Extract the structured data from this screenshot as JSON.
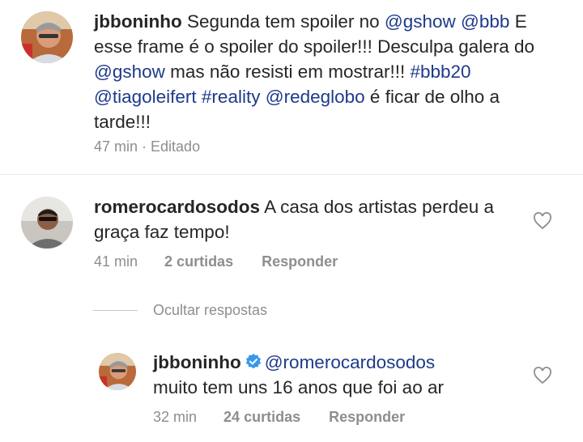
{
  "post": {
    "username": "jbboninho",
    "caption_parts": [
      {
        "t": " Segunda tem spoiler no ",
        "link": false
      },
      {
        "t": "@gshow",
        "link": true
      },
      {
        "t": " ",
        "link": false
      },
      {
        "t": "@bbb",
        "link": true
      },
      {
        "t": " E esse frame é o spoiler do spoiler!!! Desculpa galera do ",
        "link": false
      },
      {
        "t": "@gshow",
        "link": true
      },
      {
        "t": " mas não resisti em mostrar!!! ",
        "link": false
      },
      {
        "t": "#bbb20",
        "link": true
      },
      {
        "t": " ",
        "link": false
      },
      {
        "t": "@tiagoleifert",
        "link": true
      },
      {
        "t": " ",
        "link": false
      },
      {
        "t": "#reality",
        "link": true
      },
      {
        "t": " ",
        "link": false
      },
      {
        "t": "@redeglobo",
        "link": true
      },
      {
        "t": " é ficar de olho a tarde!!!",
        "link": false
      }
    ],
    "time": "47 min",
    "edited": "Editado"
  },
  "comment": {
    "username": "romerocardosodos",
    "text": " A casa dos artistas perdeu a graça faz tempo!",
    "time": "41 min",
    "likes": "2 curtidas",
    "reply_label": "Responder"
  },
  "replies_toggle": "Ocultar respostas",
  "reply": {
    "username": "jbboninho",
    "mention": "@romerocardosodos",
    "text": "muito tem uns 16 anos que foi ao ar",
    "time": "32 min",
    "likes": "24 curtidas",
    "reply_label": "Responder"
  },
  "colors": {
    "link": "#1e3a8a",
    "meta": "#8e8e8e",
    "verified": "#3897f0"
  }
}
